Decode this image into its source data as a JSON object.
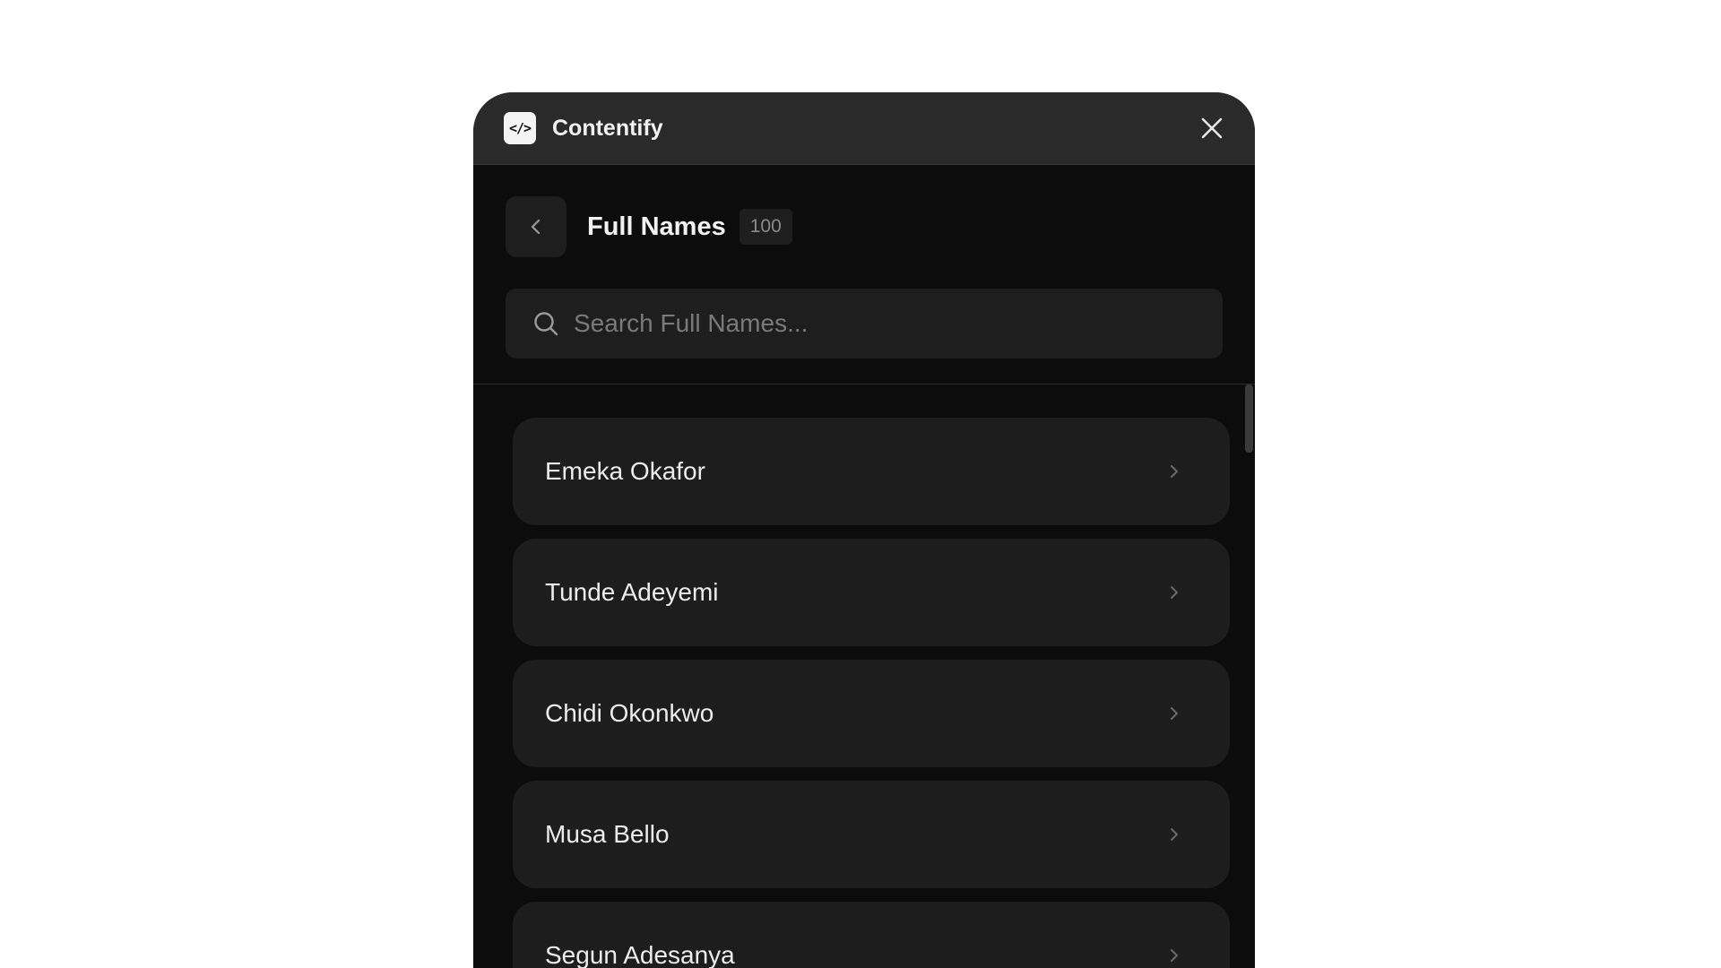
{
  "app": {
    "logo_text": "</>",
    "name": "Contentify",
    "close_icon": "close-icon"
  },
  "header": {
    "title": "Full Names",
    "count": "100",
    "back_icon": "chevron-left-icon"
  },
  "search": {
    "placeholder": "Search Full Names...",
    "value": ""
  },
  "items": [
    {
      "label": "Emeka Okafor"
    },
    {
      "label": "Tunde Adeyemi"
    },
    {
      "label": "Chidi Okonkwo"
    },
    {
      "label": "Musa Bello"
    },
    {
      "label": "Segun Adesanya"
    }
  ],
  "colors": {
    "panel_bg": "#0c0c0c",
    "titlebar_bg": "#2a2a2a",
    "item_bg": "#1d1d1d",
    "text": "#ececec"
  }
}
